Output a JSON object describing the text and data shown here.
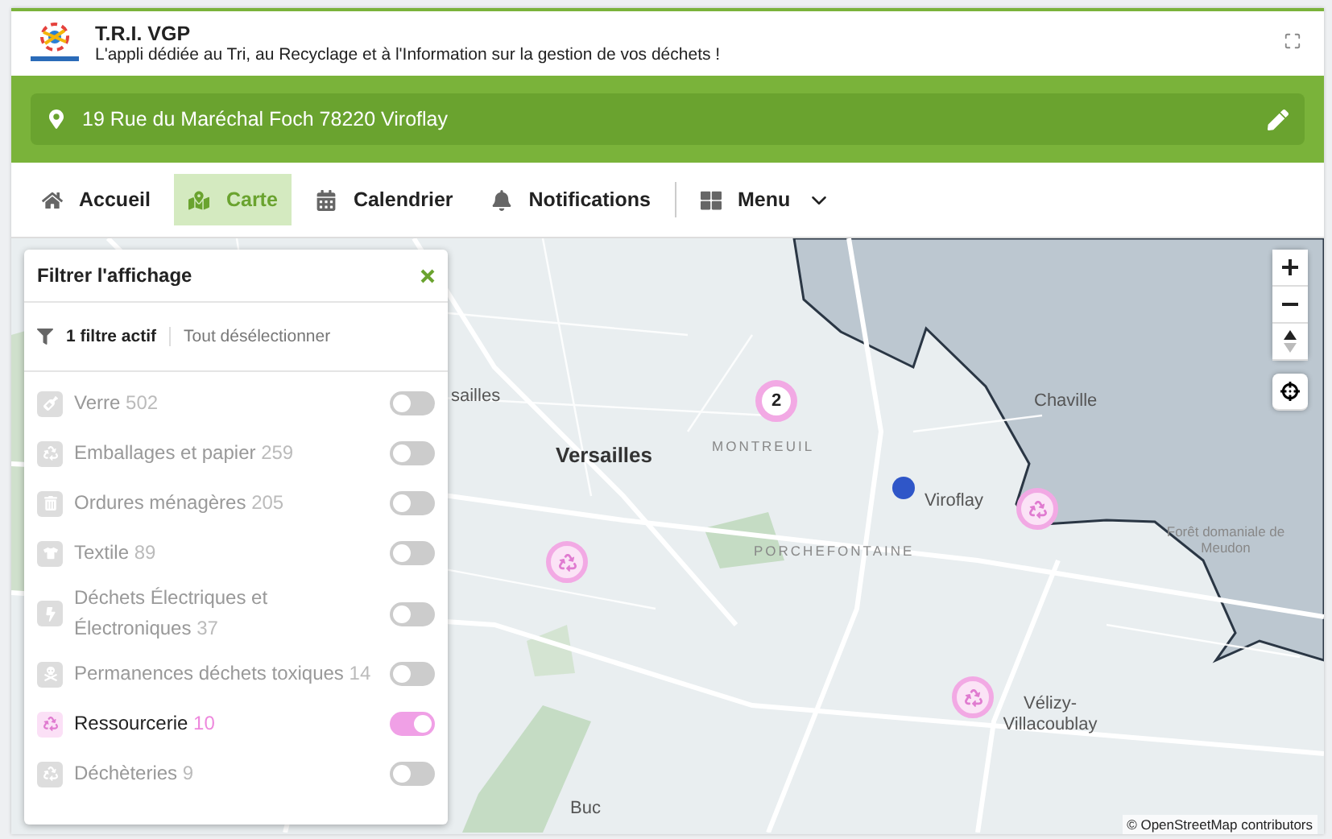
{
  "header": {
    "title": "T.R.I. VGP",
    "subtitle": "L'appli dédiée au Tri, au Recyclage et à l'Information sur la gestion de vos déchets !"
  },
  "address": {
    "value": "19 Rue du Maréchal Foch 78220 Viroflay"
  },
  "nav": [
    {
      "label": "Accueil",
      "selected": false
    },
    {
      "label": "Carte",
      "selected": true
    },
    {
      "label": "Calendrier",
      "selected": false
    },
    {
      "label": "Notifications",
      "selected": false
    },
    {
      "label": "Menu",
      "selected": false
    }
  ],
  "filter_panel": {
    "title": "Filtrer l'affichage",
    "active_count": "1 filtre actif",
    "deselect_all": "Tout désélectionner",
    "items": [
      {
        "name": "Verre",
        "count": "502",
        "on": false
      },
      {
        "name": "Emballages et papier",
        "count": "259",
        "on": false
      },
      {
        "name": "Ordures ménagères",
        "count": "205",
        "on": false
      },
      {
        "name": "Textile",
        "count": "89",
        "on": false
      },
      {
        "name": "Déchets Électriques et Électroniques",
        "count": "37",
        "on": false
      },
      {
        "name": "Permanences déchets toxiques",
        "count": "14",
        "on": false
      },
      {
        "name": "Ressourcerie",
        "count": "10",
        "on": true
      },
      {
        "name": "Déchèteries",
        "count": "9",
        "on": false
      }
    ]
  },
  "map": {
    "labels": [
      {
        "text": "sailles",
        "kind": "place"
      },
      {
        "text": "Versailles",
        "kind": "city"
      },
      {
        "text": "MONTREUIL",
        "kind": "district"
      },
      {
        "text": "Viroflay",
        "kind": "place"
      },
      {
        "text": "PORCHEFONTAINE",
        "kind": "district"
      },
      {
        "text": "Chaville",
        "kind": "place"
      },
      {
        "text": "Forêt domaniale de Meudon",
        "kind": "forest"
      },
      {
        "text": "Vélizy-Villacoublay",
        "kind": "place"
      },
      {
        "text": "Buc",
        "kind": "place"
      }
    ],
    "cluster": {
      "count": "2"
    },
    "attribution": "© OpenStreetMap contributors"
  }
}
